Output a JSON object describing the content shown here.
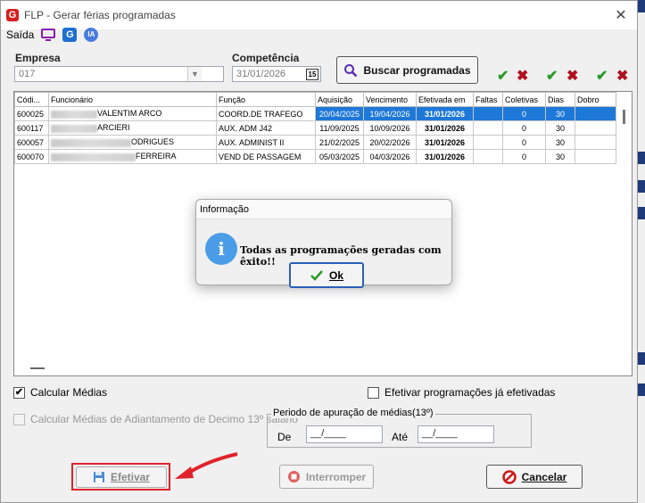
{
  "window": {
    "title": "FLP - Gerar férias programadas",
    "app_logo": "G",
    "close_icon": "✕"
  },
  "menubar": {
    "saida_label": "Saída",
    "icons": [
      "monitor-icon",
      "g-app-icon",
      "ia-icon"
    ],
    "ia_text": "IA",
    "g_text": "G"
  },
  "empresa": {
    "label": "Empresa",
    "value": "017"
  },
  "competencia": {
    "label": "Competência",
    "value": "31/01/2026",
    "cal_text": "15"
  },
  "buscar_button": {
    "label": "Buscar programadas"
  },
  "table": {
    "headers": [
      "Códi...",
      "Funcionário",
      "Função",
      "Aquisição",
      "Vencimento",
      "Efetivada em",
      "Faltas",
      "Coletivas",
      "Dias",
      "Dobro"
    ],
    "rows": [
      {
        "codigo": "600025",
        "funcionario": "VALENTIM ARCO",
        "funcao": "COORD.DE TRAFEGO",
        "aquisicao": "20/04/2025",
        "vencimento": "19/04/2026",
        "efetivada": "31/01/2026",
        "faltas": "",
        "coletivas": "0",
        "dias": "30",
        "dobro": ""
      },
      {
        "codigo": "600117",
        "funcionario": "ARCIERI",
        "funcao": "AUX. ADM J42",
        "aquisicao": "11/09/2025",
        "vencimento": "10/09/2026",
        "efetivada": "31/01/2026",
        "faltas": "",
        "coletivas": "0",
        "dias": "30",
        "dobro": ""
      },
      {
        "codigo": "600057",
        "funcionario": "ODRIGUES",
        "funcao": "AUX. ADMINIST II",
        "aquisicao": "21/02/2025",
        "vencimento": "20/02/2026",
        "efetivada": "31/01/2026",
        "faltas": "",
        "coletivas": "0",
        "dias": "30",
        "dobro": ""
      },
      {
        "codigo": "600070",
        "funcionario": "FERREIRA",
        "funcao": "VEND DE PASSAGEM",
        "aquisicao": "05/03/2025",
        "vencimento": "04/03/2026",
        "efetivada": "31/01/2026",
        "faltas": "",
        "coletivas": "0",
        "dias": "30",
        "dobro": ""
      }
    ]
  },
  "options": {
    "calcular_medias": "Calcular Médias",
    "efetivar_ja": "Efetivar programações já efetivadas",
    "calcular_adiantamento": "Calcular Médias de Adiantamento de Decimo 13º sálario"
  },
  "periodo": {
    "legend": "Periodo de apuração de médias(13º)",
    "de_label": "De",
    "de_value": "__/____",
    "ate_label": "Até",
    "ate_value": "__/____"
  },
  "buttons": {
    "efetivar": "Efetivar",
    "interromper": "Interromper",
    "cancelar": "Cancelar"
  },
  "dialog": {
    "title": "Informação",
    "message": "Todas as programações geradas com êxito!!",
    "ok": "Ok",
    "info_glyph": "i"
  },
  "colors": {
    "selection": "#1e78d8",
    "accept": "#2a9a2a",
    "reject": "#b01020",
    "highlight": "#e0232b"
  }
}
